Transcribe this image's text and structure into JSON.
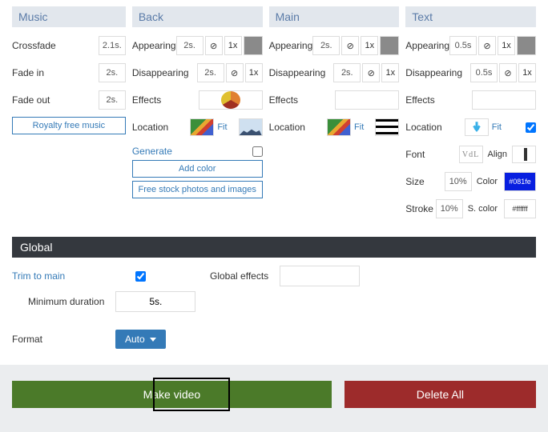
{
  "music": {
    "header": "Music",
    "crossfade_label": "Crossfade",
    "crossfade_val": "2.1s.",
    "fadein_label": "Fade in",
    "fadein_val": "2s.",
    "fadeout_label": "Fade out",
    "fadeout_val": "2s.",
    "royalty_btn": "Royalty free music"
  },
  "back": {
    "header": "Back",
    "appearing_label": "Appearing",
    "appearing_val": "2s.",
    "appearing_mult": "1x",
    "disappearing_label": "Disappearing",
    "disappearing_val": "2s.",
    "disappearing_mult": "1x",
    "effects_label": "Effects",
    "location_label": "Location",
    "fit_label": "Fit",
    "generate_label": "Generate",
    "addcolor_btn": "Add color",
    "freestock_btn": "Free stock photos and images"
  },
  "main": {
    "header": "Main",
    "appearing_label": "Appearing",
    "appearing_val": "2s.",
    "appearing_mult": "1x",
    "disappearing_label": "Disappearing",
    "disappearing_val": "2s.",
    "disappearing_mult": "1x",
    "effects_label": "Effects",
    "location_label": "Location",
    "fit_label": "Fit"
  },
  "text": {
    "header": "Text",
    "appearing_label": "Appearing",
    "appearing_val": "0.5s",
    "appearing_mult": "1x",
    "disappearing_label": "Disappearing",
    "disappearing_val": "0.5s",
    "disappearing_mult": "1x",
    "effects_label": "Effects",
    "location_label": "Location",
    "fit_label": "Fit",
    "font_label": "Font",
    "font_sample": "VdL",
    "align_label": "Align",
    "size_label": "Size",
    "size_val": "10%",
    "color_label": "Color",
    "color_val": "#081fe",
    "stroke_label": "Stroke",
    "stroke_val": "10%",
    "scolor_label": "S. color",
    "scolor_val": "#ffffff"
  },
  "global": {
    "header": "Global",
    "trim_label": "Trim to main",
    "globaleffects_label": "Global effects",
    "minduration_label": "Minimum duration",
    "minduration_val": "5s.",
    "format_label": "Format",
    "format_val": "Auto"
  },
  "actions": {
    "make": "Make video",
    "delete": "Delete All"
  },
  "icons": {
    "denied": "⊘"
  }
}
